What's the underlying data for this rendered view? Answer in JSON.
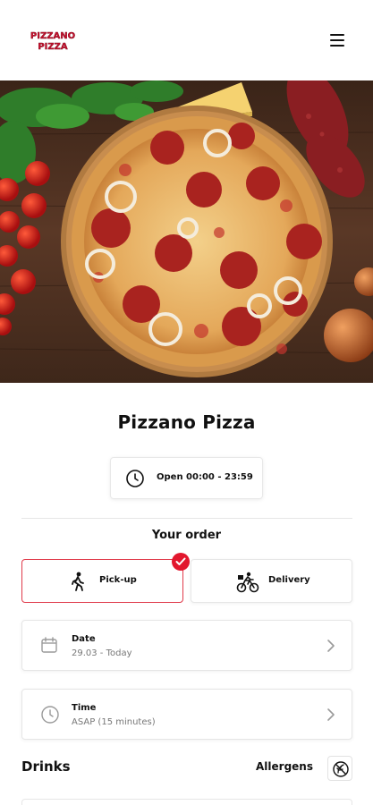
{
  "header": {
    "logo_text": "PIZZANO PIZZA",
    "brand_color": "#c8102e",
    "menu_icon": "hamburger-menu-icon"
  },
  "hero": {
    "image_subject": "pepperoni pizza on wooden board"
  },
  "restaurant": {
    "name": "Pizzano Pizza",
    "hours_icon": "clock-icon",
    "hours": "Open 00:00 - 23:59"
  },
  "order": {
    "heading": "Your order",
    "accent_color": "#e2172e",
    "options": [
      {
        "label": "Pick-up",
        "icon": "walking-person-icon",
        "selected": true
      },
      {
        "label": "Delivery",
        "icon": "bicycle-courier-icon",
        "selected": false
      }
    ],
    "date": {
      "label": "Date",
      "value": "29.03 - Today",
      "icon": "calendar-icon"
    },
    "time": {
      "label": "Time",
      "value": "ASAP (15 minutes)",
      "icon": "clock-icon"
    }
  },
  "menu": {
    "section_title": "Drinks",
    "allergens_label": "Allergens",
    "allergens_icon": "wheat-crossed-icon"
  }
}
